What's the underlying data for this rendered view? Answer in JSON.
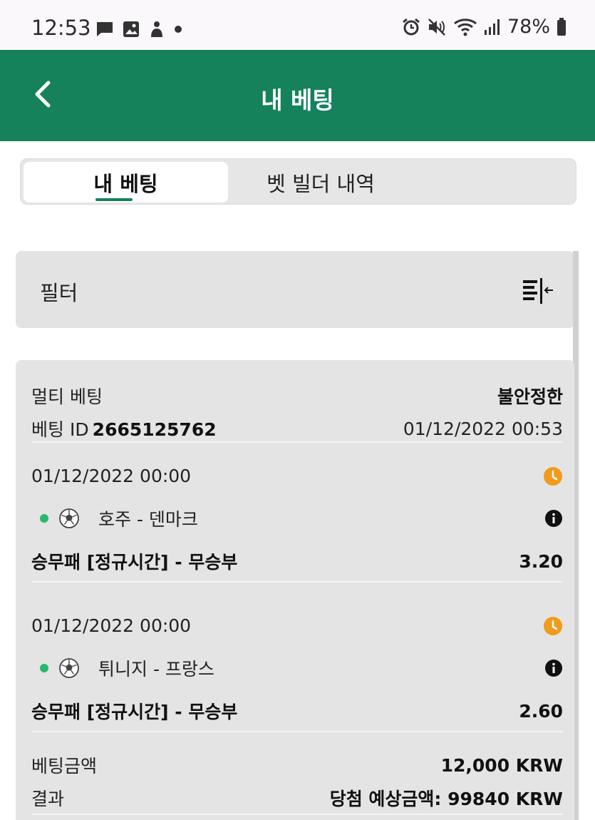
{
  "status_bar": {
    "time": "12:53",
    "battery": "78%",
    "left_icons": [
      "message-icon",
      "image-icon",
      "app-icon",
      "dot-icon"
    ],
    "right_icons": [
      "alarm-icon",
      "mute-icon",
      "wifi-icon",
      "signal-icon",
      "battery-icon"
    ]
  },
  "header": {
    "title": "내 베팅"
  },
  "tabs": [
    {
      "label": "내 베팅",
      "active": true
    },
    {
      "label": "벳 빌더 내역",
      "active": false
    }
  ],
  "filter": {
    "label": "필터"
  },
  "bet": {
    "type": "멀티 베팅",
    "status": "불안정한",
    "id_label": "베팅 ID",
    "id_value": "2665125762",
    "placed_at": "01/12/2022 00:53",
    "selections": [
      {
        "datetime": "01/12/2022 00:00",
        "match": "호주 - 덴마크",
        "market": "승무패 [정규시간] - 무승부",
        "odds": "3.20"
      },
      {
        "datetime": "01/12/2022 00:00",
        "match": "튀니지 - 프랑스",
        "market": "승무패 [정규시간] - 무승부",
        "odds": "2.60"
      }
    ],
    "stake_label": "베팅금액",
    "stake_value": "12,000 KRW",
    "result_label": "결과",
    "result_value": "당첨 예상금액: 99840 KRW"
  },
  "colors": {
    "brand_green": "#15825c",
    "live_dot": "#27b86b",
    "pending_clock": "#f29a1c"
  }
}
